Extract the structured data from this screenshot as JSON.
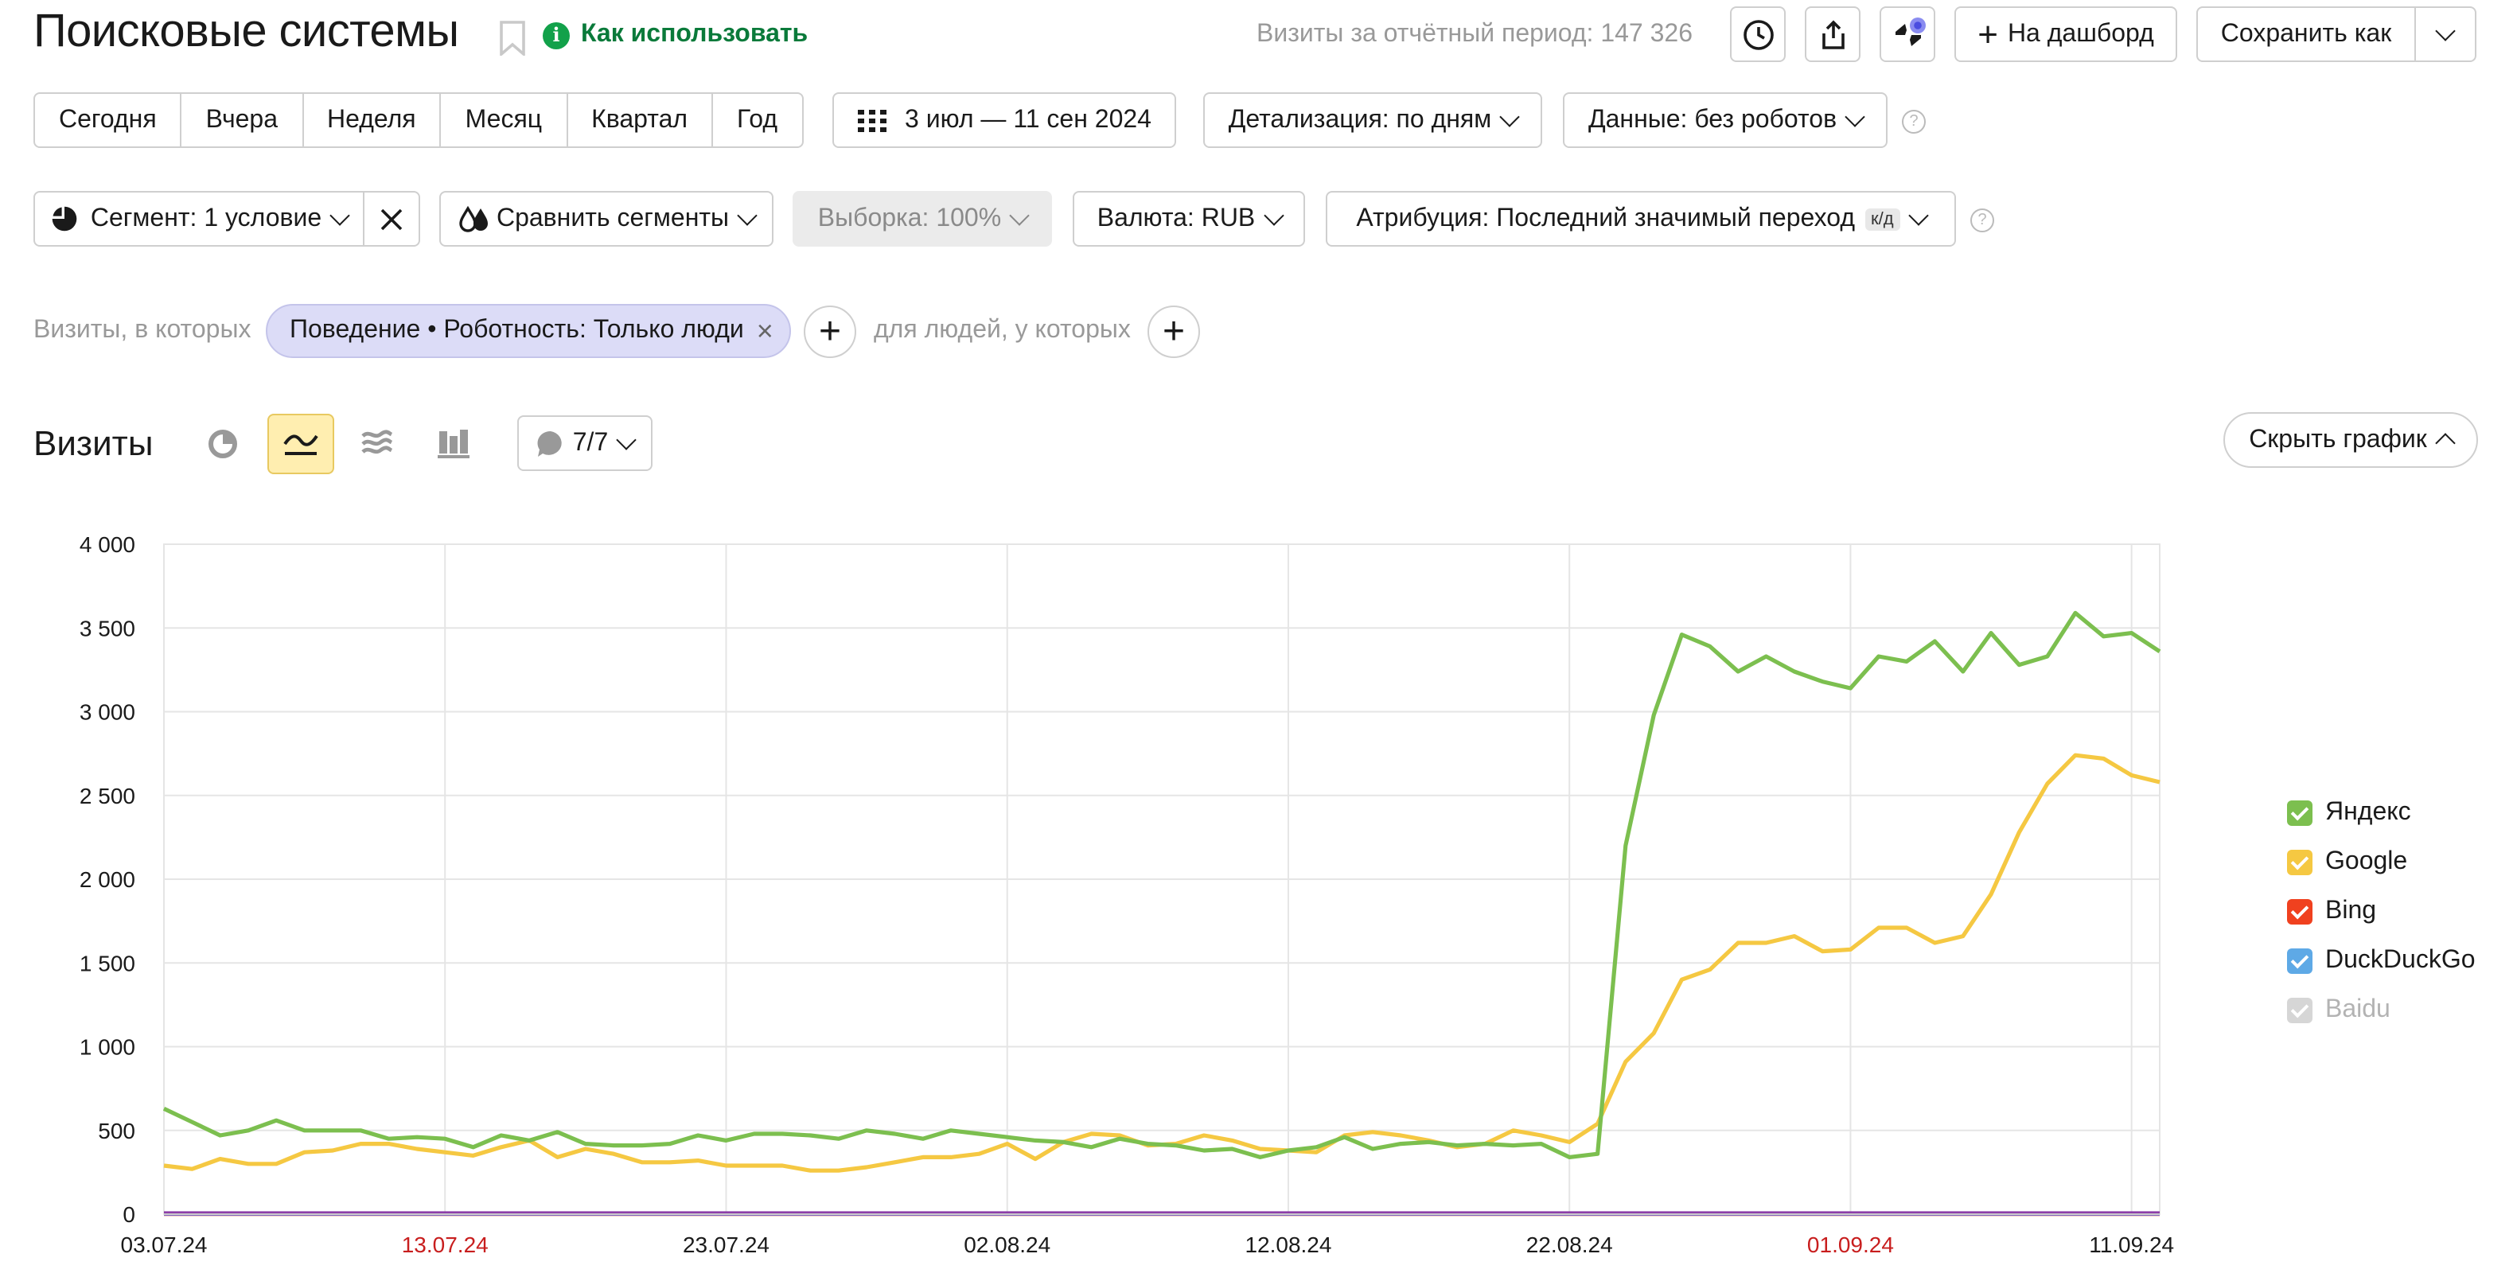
{
  "header": {
    "title": "Поисковые системы",
    "how_to_use": "Как использовать",
    "visits_total": "Визиты за отчётный период: 147 326",
    "to_dashboard": "На дашборд",
    "save_as": "Сохранить как"
  },
  "periods": [
    "Сегодня",
    "Вчера",
    "Неделя",
    "Месяц",
    "Квартал",
    "Год"
  ],
  "date_range": "3 июл — 11 сен 2024",
  "detail": "Детализация: по дням",
  "data_mode": "Данные: без роботов",
  "segment": "Сегмент: 1 условие",
  "compare": "Сравнить сегменты",
  "sample": "Выборка: 100%",
  "currency": "Валюта: RUB",
  "attribution": "Атрибуция: Последний значимый переход",
  "attribution_badge": "к/д",
  "filter": {
    "prefix": "Визиты, в которых",
    "chip": "Поведение • Роботность: Только люди",
    "people": "для людей, у которых"
  },
  "chart_header": {
    "title": "Визиты",
    "annotations": "7/7",
    "hide_chart": "Скрыть график"
  },
  "colors": {
    "yandex": "#7cbf4f",
    "google": "#f5c842",
    "bing": "#f0411f",
    "duckduckgo": "#5ea9e6",
    "baidu": "#c9c9c9",
    "other": "#8c3ea8"
  },
  "chart_data": {
    "type": "line",
    "title": "",
    "xlabel": "",
    "ylabel": "",
    "ylim": [
      0,
      4000
    ],
    "yticks": [
      "0",
      "500",
      "1 000",
      "1 500",
      "2 000",
      "2 500",
      "3 000",
      "3 500",
      "4 000"
    ],
    "xticks": [
      {
        "label": "03.07.24",
        "index": 0,
        "weekend": false
      },
      {
        "label": "13.07.24",
        "index": 10,
        "weekend": true
      },
      {
        "label": "23.07.24",
        "index": 20,
        "weekend": false
      },
      {
        "label": "02.08.24",
        "index": 30,
        "weekend": false
      },
      {
        "label": "12.08.24",
        "index": 40,
        "weekend": false
      },
      {
        "label": "22.08.24",
        "index": 50,
        "weekend": false
      },
      {
        "label": "01.09.24",
        "index": 60,
        "weekend": true
      },
      {
        "label": "11.09.24",
        "index": 70,
        "weekend": false
      }
    ],
    "grid": true,
    "legend_position": "right",
    "series": [
      {
        "name": "Яндекс",
        "key": "yandex",
        "checked": true,
        "values": [
          630,
          550,
          470,
          500,
          560,
          500,
          500,
          500,
          450,
          460,
          450,
          400,
          470,
          440,
          490,
          420,
          410,
          410,
          420,
          470,
          440,
          480,
          480,
          470,
          450,
          500,
          480,
          450,
          500,
          480,
          460,
          440,
          430,
          400,
          450,
          420,
          410,
          380,
          390,
          340,
          380,
          400,
          460,
          390,
          420,
          430,
          410,
          420,
          410,
          420,
          340,
          360,
          2200,
          2980,
          3460,
          3390,
          3240,
          3330,
          3240,
          3180,
          3140,
          3330,
          3300,
          3420,
          3240,
          3470,
          3280,
          3330,
          3590,
          3450,
          3470,
          3360
        ]
      },
      {
        "name": "Google",
        "key": "google",
        "checked": true,
        "values": [
          290,
          270,
          330,
          300,
          300,
          370,
          380,
          420,
          420,
          390,
          370,
          350,
          400,
          440,
          340,
          390,
          360,
          310,
          310,
          320,
          290,
          290,
          290,
          260,
          260,
          280,
          310,
          340,
          340,
          360,
          420,
          330,
          430,
          480,
          470,
          410,
          420,
          470,
          440,
          390,
          380,
          370,
          470,
          490,
          470,
          440,
          400,
          420,
          500,
          470,
          430,
          540,
          910,
          1080,
          1400,
          1460,
          1620,
          1620,
          1660,
          1570,
          1580,
          1710,
          1710,
          1620,
          1660,
          1910,
          2280,
          2570,
          2740,
          2720,
          2620,
          2580
        ]
      },
      {
        "name": "Bing",
        "key": "bing",
        "checked": true,
        "values": [
          2,
          2,
          2,
          2,
          2,
          2,
          2,
          2,
          2,
          2,
          2,
          2,
          2,
          2,
          2,
          2,
          2,
          2,
          2,
          2,
          2,
          2,
          2,
          2,
          2,
          2,
          2,
          2,
          2,
          2,
          2,
          2,
          2,
          2,
          2,
          2,
          2,
          2,
          2,
          2,
          2,
          2,
          2,
          2,
          2,
          2,
          2,
          2,
          2,
          2,
          2,
          2,
          2,
          2,
          2,
          2,
          2,
          2,
          2,
          2,
          2,
          2,
          2,
          2,
          2,
          2,
          2,
          2,
          2,
          2,
          2,
          2
        ]
      },
      {
        "name": "DuckDuckGo",
        "key": "duckduckgo",
        "checked": true,
        "values": [
          3,
          3,
          3,
          3,
          3,
          3,
          3,
          3,
          3,
          3,
          3,
          3,
          3,
          3,
          3,
          3,
          3,
          3,
          3,
          3,
          3,
          3,
          3,
          3,
          3,
          3,
          3,
          3,
          3,
          3,
          3,
          3,
          3,
          3,
          3,
          3,
          3,
          3,
          3,
          3,
          3,
          3,
          3,
          3,
          3,
          3,
          3,
          3,
          3,
          3,
          3,
          3,
          3,
          3,
          3,
          3,
          3,
          3,
          3,
          3,
          3,
          3,
          3,
          3,
          3,
          3,
          3,
          3,
          3,
          3,
          3,
          3
        ]
      },
      {
        "name": "Baidu",
        "key": "baidu",
        "checked": false,
        "values": []
      },
      {
        "name": "",
        "key": "other",
        "checked": true,
        "values": [
          5,
          5,
          5,
          5,
          5,
          5,
          5,
          5,
          5,
          5,
          5,
          5,
          5,
          5,
          5,
          5,
          5,
          5,
          5,
          5,
          5,
          5,
          5,
          5,
          5,
          5,
          5,
          5,
          5,
          5,
          5,
          5,
          5,
          5,
          5,
          5,
          5,
          5,
          5,
          5,
          5,
          5,
          5,
          5,
          5,
          5,
          5,
          5,
          5,
          5,
          5,
          5,
          5,
          5,
          5,
          5,
          5,
          5,
          5,
          5,
          5,
          5,
          5,
          5,
          5,
          5,
          5,
          5,
          5,
          5,
          5,
          5
        ]
      }
    ]
  }
}
